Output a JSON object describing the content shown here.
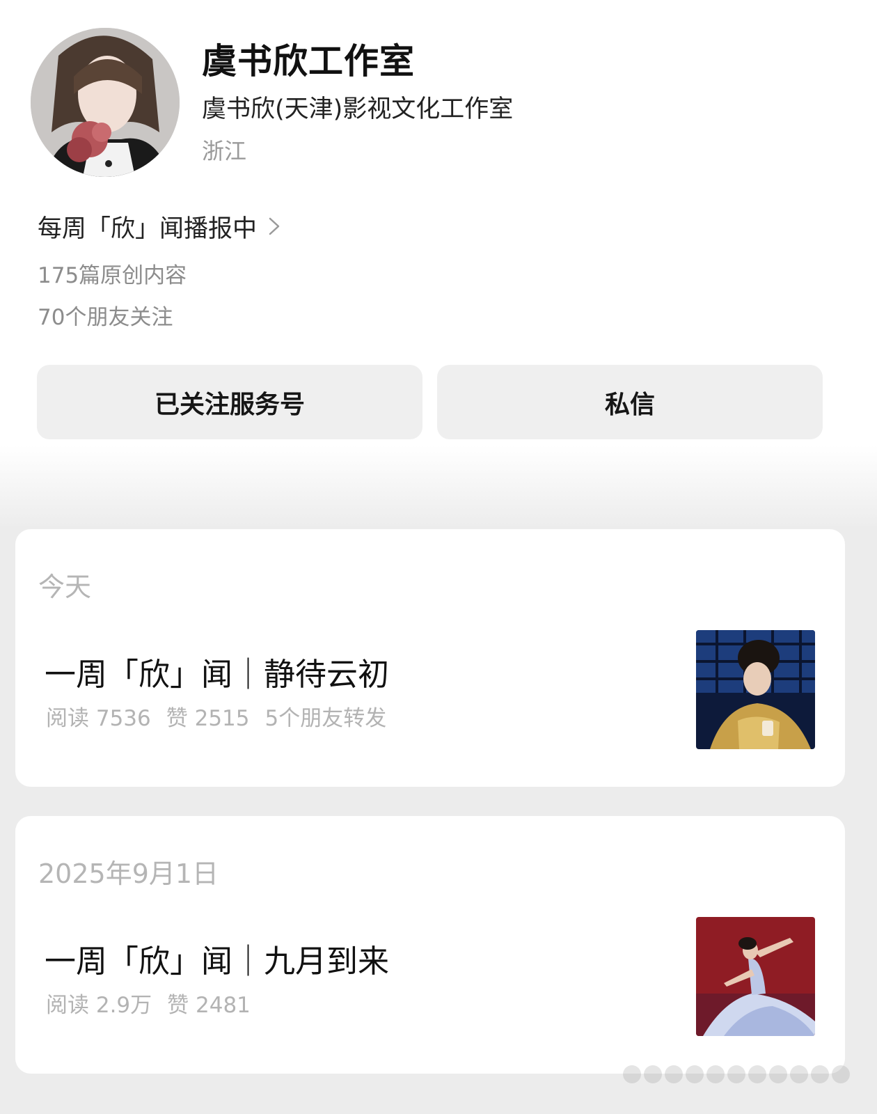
{
  "profile": {
    "name": "虞书欣工作室",
    "company": "虞书欣(天津)影视文化工作室",
    "location": "浙江",
    "intro": "每周「欣」闻播报中",
    "original_count": "175篇原创内容",
    "friends_following": "70个朋友关注"
  },
  "actions": {
    "follow_label": "已关注服务号",
    "message_label": "私信"
  },
  "articles": [
    {
      "date": "今天",
      "title": "一周「欣」闻｜静待云初",
      "reads": "阅读 7536",
      "likes": "赞 2515",
      "shares": "5个朋友转发"
    },
    {
      "date": "2025年9月1日",
      "title": "一周「欣」闻｜九月到来",
      "reads": "阅读 2.9万",
      "likes": "赞 2481"
    }
  ],
  "icons": {
    "intro_arrow": "chevron-right-icon"
  },
  "colors": {
    "button_bg": "#efefef",
    "page_bg": "#ececec",
    "muted_text": "#b3b3b3"
  }
}
